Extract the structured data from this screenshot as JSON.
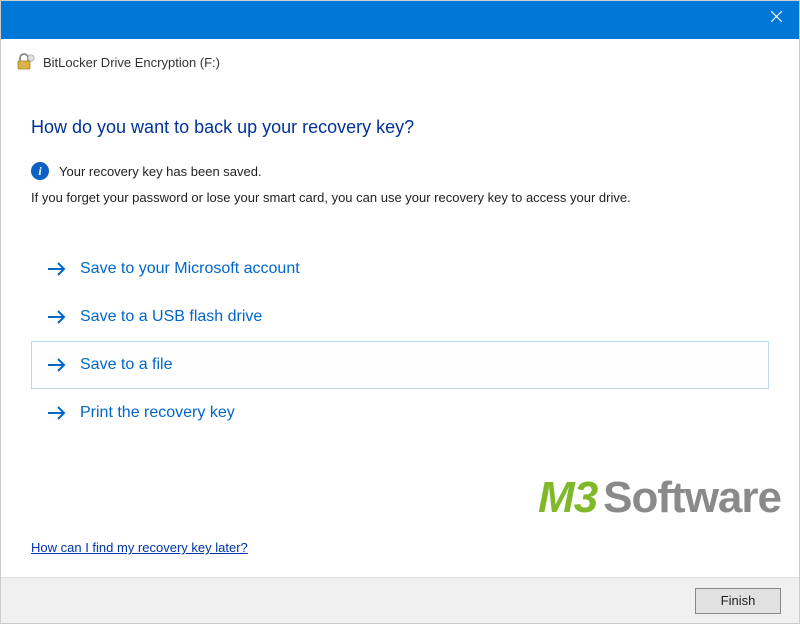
{
  "window": {
    "title": "BitLocker Drive Encryption (F:)"
  },
  "page": {
    "heading": "How do you want to back up your recovery key?",
    "info_message": "Your recovery key has been saved.",
    "description": "If you forget your password or lose your smart card, you can use your recovery key to access your drive."
  },
  "options": [
    {
      "label": "Save to your Microsoft account",
      "selected": false
    },
    {
      "label": "Save to a USB flash drive",
      "selected": false
    },
    {
      "label": "Save to a file",
      "selected": true
    },
    {
      "label": "Print the recovery key",
      "selected": false
    }
  ],
  "help_link": "How can I find my recovery key later?",
  "footer": {
    "finish_label": "Finish"
  },
  "watermark": {
    "brand_part1": "M3",
    "brand_part2": "Software"
  }
}
